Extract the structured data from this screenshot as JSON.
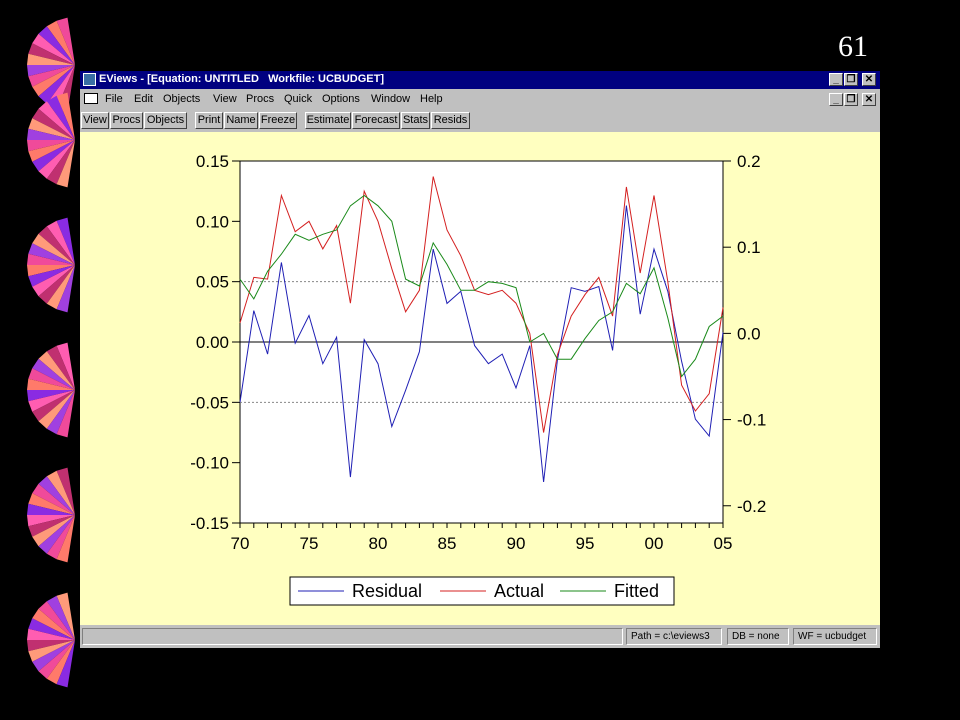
{
  "slide": {
    "number": "61"
  },
  "window": {
    "title": "EViews - [Equation: UNTITLED   Workfile: UCBUDGET]",
    "controls": {
      "minimize": "_",
      "restore": "❐",
      "close": "✕"
    }
  },
  "menu": [
    "File",
    "Edit",
    "Objects",
    "View",
    "Procs",
    "Quick",
    "Options",
    "Window",
    "Help"
  ],
  "toolbar": [
    "View",
    "Procs",
    "Objects",
    "Print",
    "Name",
    "Freeze",
    "Estimate",
    "Forecast",
    "Stats",
    "Resids"
  ],
  "status": {
    "path": "Path = c:\\eviews3",
    "db": "DB = none",
    "wf": "WF = ucbudget"
  },
  "colors": {
    "residual": "#1f1fb4",
    "actual": "#d42020",
    "fitted": "#1a8a1a",
    "pane": "#ffffc0",
    "titlebar": "#000080"
  },
  "chart_data": {
    "type": "line",
    "x": [
      1970,
      1971,
      1972,
      1973,
      1974,
      1975,
      1976,
      1977,
      1978,
      1979,
      1980,
      1981,
      1982,
      1983,
      1984,
      1985,
      1986,
      1987,
      1988,
      1989,
      1990,
      1991,
      1992,
      1993,
      1994,
      1995,
      1996,
      1997,
      1998,
      1999,
      2000,
      2001,
      2002,
      2003,
      2004,
      2005
    ],
    "xticks": [
      "70",
      "75",
      "80",
      "85",
      "90",
      "95",
      "00",
      "05"
    ],
    "xlim": [
      1970,
      2005
    ],
    "left_axis": {
      "ticks": [
        "0.15",
        "0.10",
        "0.05",
        "0.00",
        "-0.05",
        "-0.10",
        "-0.15"
      ],
      "ylim": [
        -0.15,
        0.15
      ]
    },
    "right_axis": {
      "ticks": [
        "0.2",
        "0.1",
        "0.0",
        "-0.1",
        "-0.2"
      ],
      "ylim": [
        -0.22,
        0.2
      ]
    },
    "series": [
      {
        "name": "Residual",
        "axis": "left",
        "values": [
          -0.05,
          0.026,
          -0.01,
          0.066,
          -0.001,
          0.022,
          -0.018,
          0.004,
          -0.112,
          0.002,
          -0.018,
          -0.07,
          -0.04,
          -0.008,
          0.077,
          0.032,
          0.042,
          -0.003,
          -0.018,
          -0.01,
          -0.038,
          -0.003,
          -0.116,
          -0.015,
          0.045,
          0.042,
          0.046,
          -0.007,
          0.113,
          0.023,
          0.077,
          0.042,
          -0.016,
          -0.064,
          -0.078,
          0.008
        ]
      },
      {
        "name": "Actual",
        "axis": "right",
        "values": [
          0.012,
          0.065,
          0.063,
          0.16,
          0.118,
          0.13,
          0.098,
          0.125,
          0.035,
          0.165,
          0.13,
          0.075,
          0.025,
          0.05,
          0.182,
          0.12,
          0.09,
          0.05,
          0.045,
          0.05,
          0.035,
          0.0,
          -0.115,
          -0.025,
          0.02,
          0.045,
          0.065,
          0.02,
          0.17,
          0.07,
          0.16,
          0.06,
          -0.06,
          -0.09,
          -0.07,
          0.03
        ]
      },
      {
        "name": "Fitted",
        "axis": "right",
        "values": [
          0.063,
          0.04,
          0.072,
          0.092,
          0.115,
          0.108,
          0.115,
          0.12,
          0.148,
          0.16,
          0.148,
          0.13,
          0.063,
          0.055,
          0.105,
          0.08,
          0.05,
          0.05,
          0.06,
          0.058,
          0.053,
          -0.01,
          0.0,
          -0.03,
          -0.03,
          -0.006,
          0.015,
          0.025,
          0.058,
          0.046,
          0.076,
          0.018,
          -0.05,
          -0.03,
          0.008,
          0.02
        ]
      }
    ],
    "legend": [
      "Residual",
      "Actual",
      "Fitted"
    ],
    "legend_placement": "bottom",
    "zero_line": true,
    "gridlines_dotted": [
      0.05,
      -0.05
    ]
  }
}
